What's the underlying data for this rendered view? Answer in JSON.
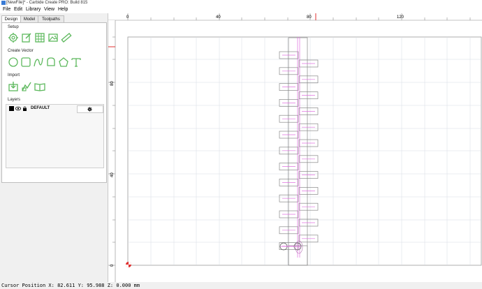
{
  "window": {
    "title": "[NewFile]* - Carbide Create PRO: Build 815"
  },
  "menu": [
    "File",
    "Edit",
    "Library",
    "View",
    "Help"
  ],
  "tabs": [
    "Design",
    "Model",
    "Toolpaths"
  ],
  "sections": {
    "setup": "Setup",
    "create_vector": "Create Vector",
    "import": "Import",
    "layers": "Layers"
  },
  "setup_tools": [
    {
      "icon": "gear-icon"
    },
    {
      "icon": "edit-icon"
    },
    {
      "icon": "grid-icon"
    },
    {
      "icon": "image-icon"
    },
    {
      "icon": "ruler-icon"
    }
  ],
  "vector_tools": [
    {
      "icon": "circle-icon"
    },
    {
      "icon": "rectangle-icon"
    },
    {
      "icon": "curve-icon"
    },
    {
      "icon": "polygon-rounded-icon"
    },
    {
      "icon": "pentagon-icon"
    },
    {
      "icon": "text-icon"
    }
  ],
  "import_tools": [
    {
      "icon": "import-icon"
    },
    {
      "icon": "import-model-icon"
    },
    {
      "icon": "book-icon"
    }
  ],
  "layers": [
    {
      "name": "DEFAULT",
      "color": "#000000"
    }
  ],
  "ruler": {
    "x_labels": [
      "0",
      "40",
      "80",
      "120"
    ],
    "y_labels": [
      "80",
      "40",
      "0"
    ]
  },
  "colors": {
    "accent": "#5cb85c",
    "magenta": "#e070e0",
    "cursor": "#e03030"
  },
  "status": {
    "cursor_text": "Cursor Position X: 82.611 Y: 95.988 Z: 0.000 mm"
  }
}
